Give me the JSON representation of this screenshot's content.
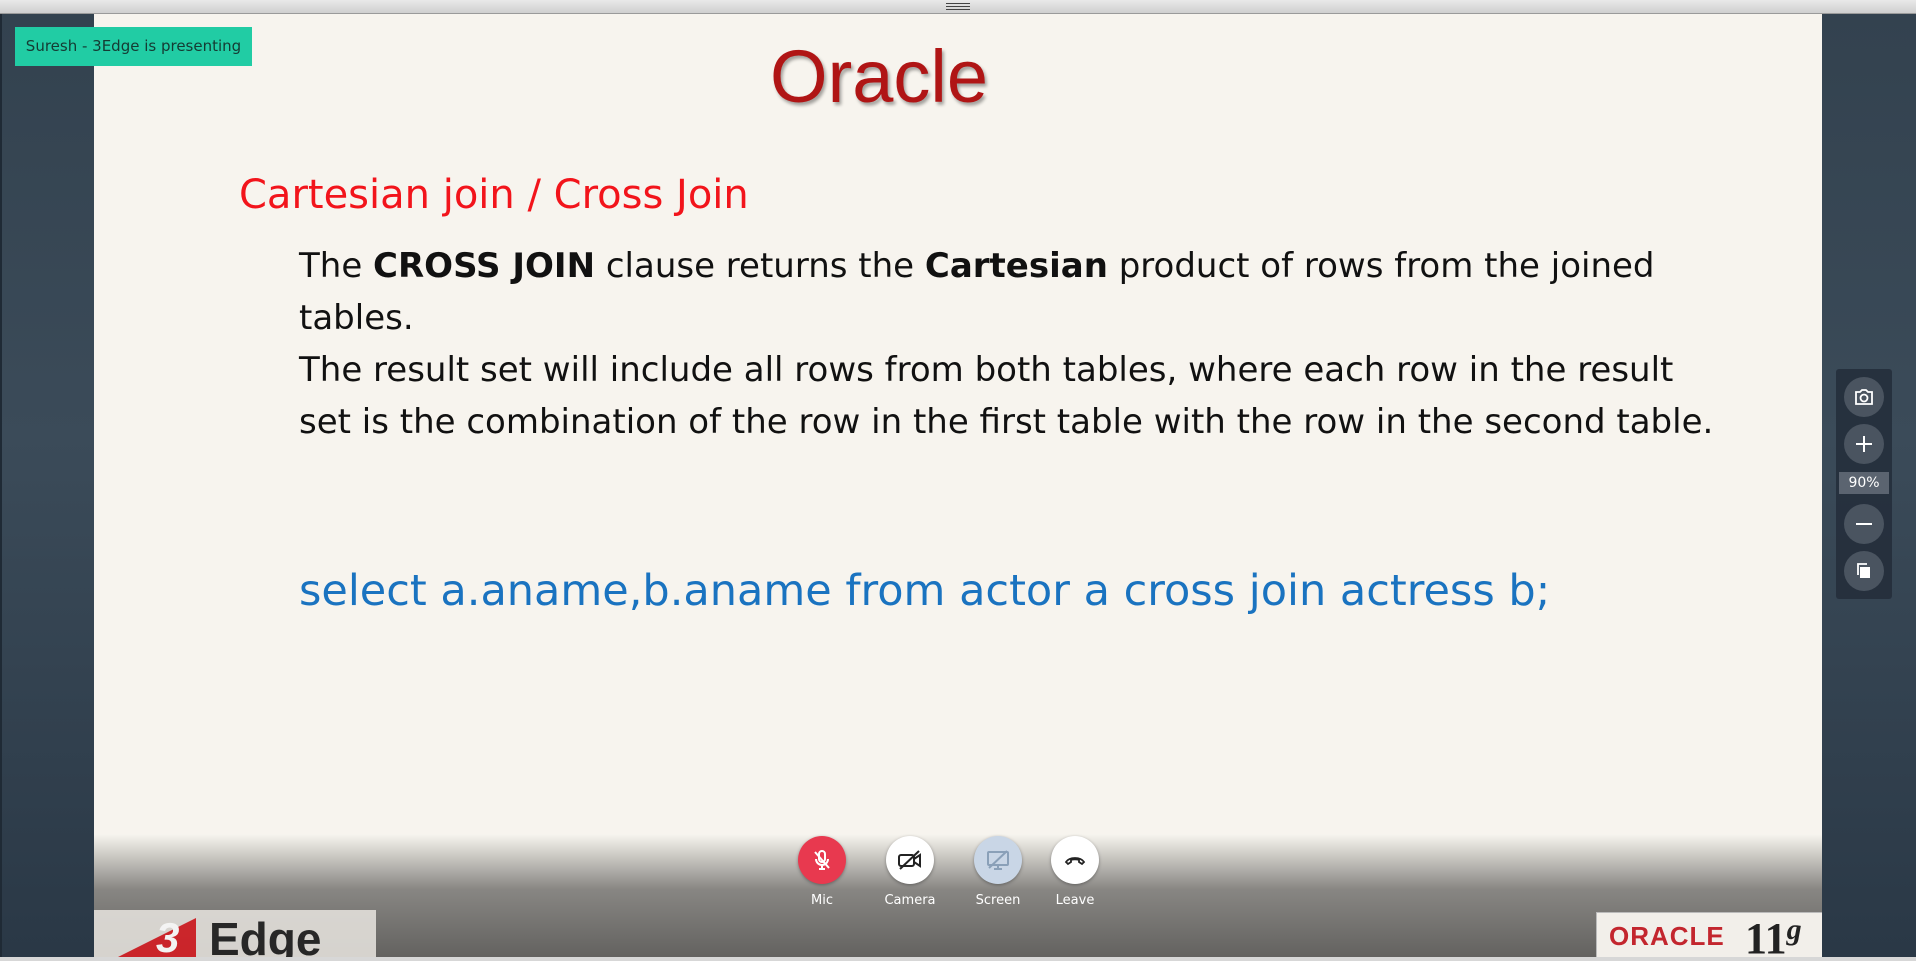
{
  "presenter_badge": "Suresh - 3Edge is presenting",
  "slide": {
    "title": "Oracle",
    "heading": "Cartesian join / Cross Join",
    "paragraph1": {
      "pre": "The ",
      "bold1": "CROSS JOIN",
      "mid": " clause returns the ",
      "bold2": "Cartesian",
      "post": " product of rows from the joined tables."
    },
    "paragraph2": "The result set will include all rows from both tables, where each row in the result set is the combination of the row in the first table with the row in the second table.",
    "code": "select a.aname,b.aname from actor a cross join actress b;",
    "logo_left": {
      "number": "3",
      "word": "Edge"
    },
    "logo_right": {
      "word": "ORACLE",
      "version": "11",
      "version_suffix": "g"
    }
  },
  "controls": [
    {
      "id": "mic",
      "label": "Mic",
      "icon": "mic-muted-icon",
      "color": "#e8394f"
    },
    {
      "id": "camera",
      "label": "Camera",
      "icon": "camera-off-icon",
      "color": "#ffffff"
    },
    {
      "id": "screen",
      "label": "Screen",
      "icon": "screen-share-icon",
      "color": "#c9d6e6"
    },
    {
      "id": "leave",
      "label": "Leave",
      "icon": "hang-up-icon",
      "color": "#ffffff"
    }
  ],
  "side_tools": {
    "zoom_level": "90%",
    "icons": [
      "camera-snapshot-icon",
      "zoom-in-icon",
      "zoom-out-icon",
      "copy-icon"
    ]
  },
  "colors": {
    "presenter_badge": "#21cca4",
    "title": "#b01515",
    "heading": "#f2141b",
    "code": "#1a73c0"
  }
}
